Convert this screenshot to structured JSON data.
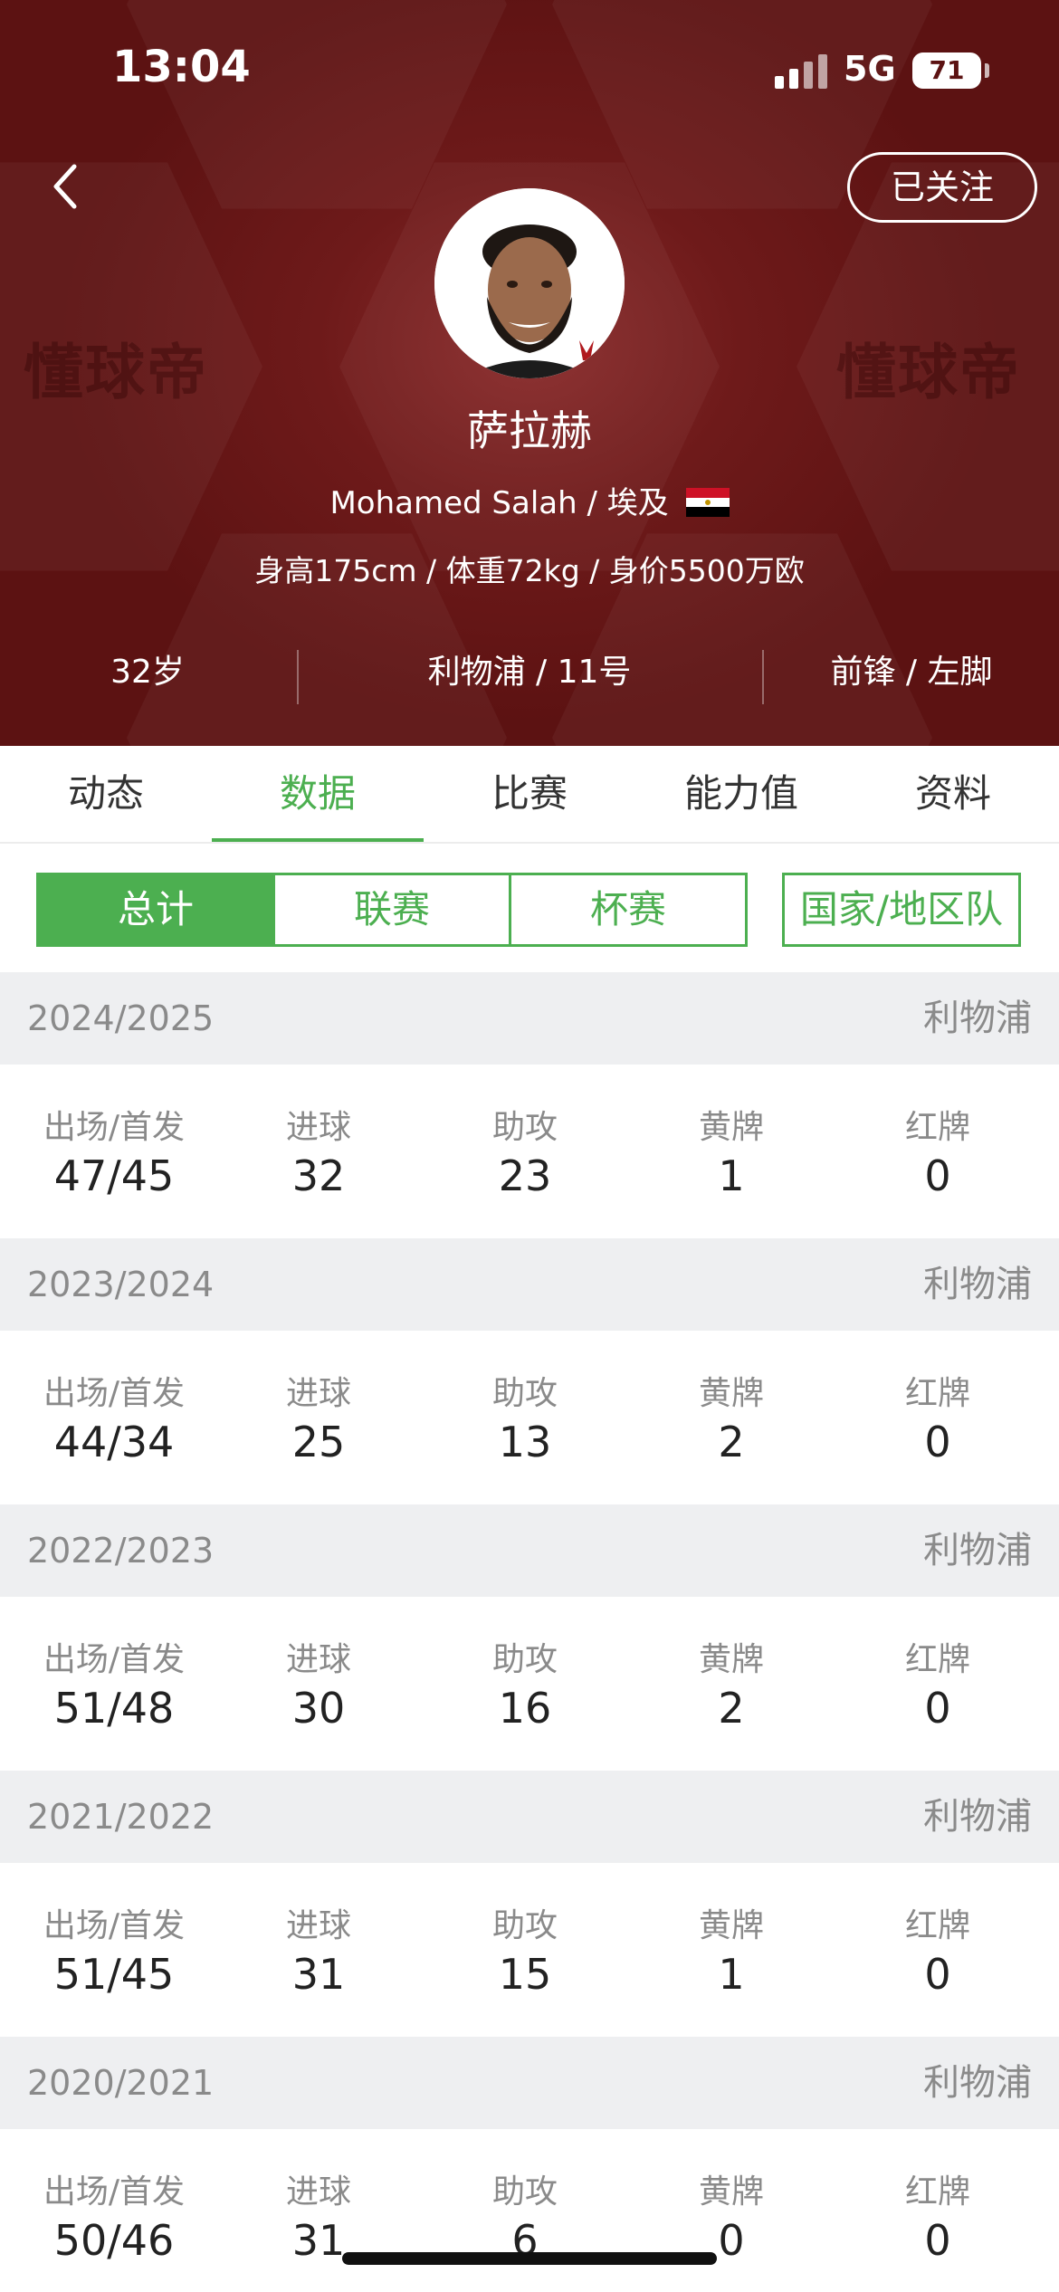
{
  "status_bar": {
    "time": "13:04",
    "network": "5G",
    "battery": "71"
  },
  "header": {
    "follow_label": "已关注",
    "watermark": "懂球帝",
    "player_name": "萨拉赫",
    "english_name": "Mohamed Salah",
    "country": "埃及",
    "body_info": "身高175cm / 体重72kg / 身价5500万欧",
    "age": "32岁",
    "club_number": "利物浦 / 11号",
    "position_foot": "前锋 / 左脚"
  },
  "tabs": [
    {
      "label": "动态"
    },
    {
      "label": "数据"
    },
    {
      "label": "比赛"
    },
    {
      "label": "能力值"
    },
    {
      "label": "资料"
    }
  ],
  "active_tab": "数据",
  "filters": [
    {
      "label": "总计"
    },
    {
      "label": "联赛"
    },
    {
      "label": "杯赛"
    },
    {
      "label": "国家/地区队"
    }
  ],
  "active_filter": "总计",
  "stat_labels": [
    "出场/首发",
    "进球",
    "助攻",
    "黄牌",
    "红牌"
  ],
  "seasons": [
    {
      "year": "2024/2025",
      "club": "利物浦",
      "values": [
        "47/45",
        "32",
        "23",
        "1",
        "0"
      ]
    },
    {
      "year": "2023/2024",
      "club": "利物浦",
      "values": [
        "44/34",
        "25",
        "13",
        "2",
        "0"
      ]
    },
    {
      "year": "2022/2023",
      "club": "利物浦",
      "values": [
        "51/48",
        "30",
        "16",
        "2",
        "0"
      ]
    },
    {
      "year": "2021/2022",
      "club": "利物浦",
      "values": [
        "51/45",
        "31",
        "15",
        "1",
        "0"
      ]
    },
    {
      "year": "2020/2021",
      "club": "利物浦",
      "values": [
        "50/46",
        "31",
        "6",
        "0",
        "0"
      ]
    }
  ],
  "colors": {
    "header_bg": "#6e1a1a",
    "accent_green": "#4caf50",
    "season_header_bg": "#eeeff1"
  }
}
